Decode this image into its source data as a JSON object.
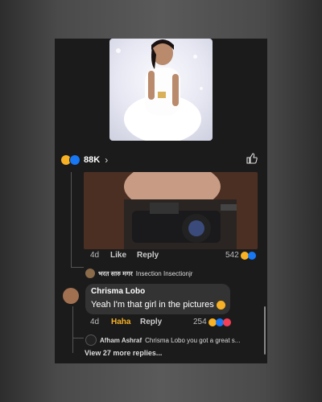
{
  "post": {
    "reaction_count": "88K",
    "chevron": "›"
  },
  "comment1": {
    "time": "4d",
    "like_label": "Like",
    "reply_label": "Reply",
    "reaction_count": "542",
    "reply_author": "भरत सारु मगर",
    "reply_text": "Insection Insectionjr"
  },
  "comment2": {
    "author": "Chrisma Lobo",
    "text": "Yeah I'm that girl in the pictures",
    "time": "4d",
    "like_label": "Haha",
    "reply_label": "Reply",
    "reaction_count": "254",
    "reply_author": "Afham Ashraf",
    "reply_text": "Chrisma Lobo you got a great s...",
    "more_replies": "View 27 more replies..."
  },
  "colors": {
    "haha": "#f7b125",
    "like_blue": "#1877f2",
    "love_red": "#f33e58"
  }
}
